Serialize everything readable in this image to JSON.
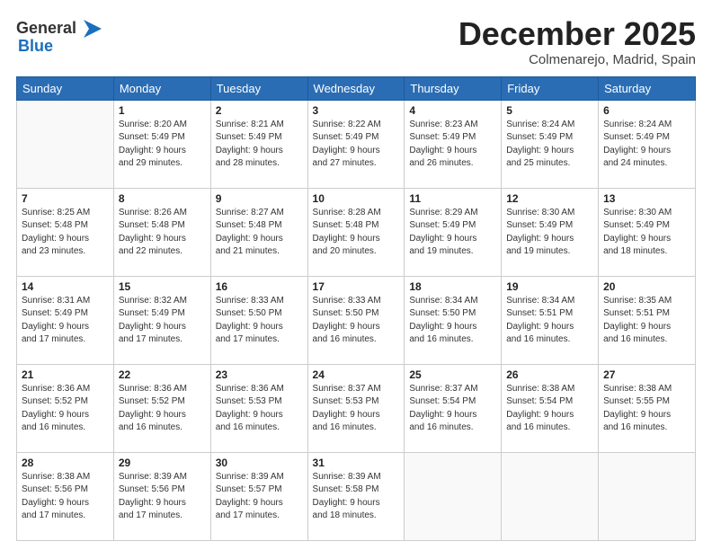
{
  "header": {
    "logo_general": "General",
    "logo_blue": "Blue",
    "month_title": "December 2025",
    "location": "Colmenarejo, Madrid, Spain"
  },
  "weekdays": [
    "Sunday",
    "Monday",
    "Tuesday",
    "Wednesday",
    "Thursday",
    "Friday",
    "Saturday"
  ],
  "weeks": [
    [
      {
        "day": "",
        "info": ""
      },
      {
        "day": "1",
        "info": "Sunrise: 8:20 AM\nSunset: 5:49 PM\nDaylight: 9 hours\nand 29 minutes."
      },
      {
        "day": "2",
        "info": "Sunrise: 8:21 AM\nSunset: 5:49 PM\nDaylight: 9 hours\nand 28 minutes."
      },
      {
        "day": "3",
        "info": "Sunrise: 8:22 AM\nSunset: 5:49 PM\nDaylight: 9 hours\nand 27 minutes."
      },
      {
        "day": "4",
        "info": "Sunrise: 8:23 AM\nSunset: 5:49 PM\nDaylight: 9 hours\nand 26 minutes."
      },
      {
        "day": "5",
        "info": "Sunrise: 8:24 AM\nSunset: 5:49 PM\nDaylight: 9 hours\nand 25 minutes."
      },
      {
        "day": "6",
        "info": "Sunrise: 8:24 AM\nSunset: 5:49 PM\nDaylight: 9 hours\nand 24 minutes."
      }
    ],
    [
      {
        "day": "7",
        "info": "Sunrise: 8:25 AM\nSunset: 5:48 PM\nDaylight: 9 hours\nand 23 minutes."
      },
      {
        "day": "8",
        "info": "Sunrise: 8:26 AM\nSunset: 5:48 PM\nDaylight: 9 hours\nand 22 minutes."
      },
      {
        "day": "9",
        "info": "Sunrise: 8:27 AM\nSunset: 5:48 PM\nDaylight: 9 hours\nand 21 minutes."
      },
      {
        "day": "10",
        "info": "Sunrise: 8:28 AM\nSunset: 5:48 PM\nDaylight: 9 hours\nand 20 minutes."
      },
      {
        "day": "11",
        "info": "Sunrise: 8:29 AM\nSunset: 5:49 PM\nDaylight: 9 hours\nand 19 minutes."
      },
      {
        "day": "12",
        "info": "Sunrise: 8:30 AM\nSunset: 5:49 PM\nDaylight: 9 hours\nand 19 minutes."
      },
      {
        "day": "13",
        "info": "Sunrise: 8:30 AM\nSunset: 5:49 PM\nDaylight: 9 hours\nand 18 minutes."
      }
    ],
    [
      {
        "day": "14",
        "info": "Sunrise: 8:31 AM\nSunset: 5:49 PM\nDaylight: 9 hours\nand 17 minutes."
      },
      {
        "day": "15",
        "info": "Sunrise: 8:32 AM\nSunset: 5:49 PM\nDaylight: 9 hours\nand 17 minutes."
      },
      {
        "day": "16",
        "info": "Sunrise: 8:33 AM\nSunset: 5:50 PM\nDaylight: 9 hours\nand 17 minutes."
      },
      {
        "day": "17",
        "info": "Sunrise: 8:33 AM\nSunset: 5:50 PM\nDaylight: 9 hours\nand 16 minutes."
      },
      {
        "day": "18",
        "info": "Sunrise: 8:34 AM\nSunset: 5:50 PM\nDaylight: 9 hours\nand 16 minutes."
      },
      {
        "day": "19",
        "info": "Sunrise: 8:34 AM\nSunset: 5:51 PM\nDaylight: 9 hours\nand 16 minutes."
      },
      {
        "day": "20",
        "info": "Sunrise: 8:35 AM\nSunset: 5:51 PM\nDaylight: 9 hours\nand 16 minutes."
      }
    ],
    [
      {
        "day": "21",
        "info": "Sunrise: 8:36 AM\nSunset: 5:52 PM\nDaylight: 9 hours\nand 16 minutes."
      },
      {
        "day": "22",
        "info": "Sunrise: 8:36 AM\nSunset: 5:52 PM\nDaylight: 9 hours\nand 16 minutes."
      },
      {
        "day": "23",
        "info": "Sunrise: 8:36 AM\nSunset: 5:53 PM\nDaylight: 9 hours\nand 16 minutes."
      },
      {
        "day": "24",
        "info": "Sunrise: 8:37 AM\nSunset: 5:53 PM\nDaylight: 9 hours\nand 16 minutes."
      },
      {
        "day": "25",
        "info": "Sunrise: 8:37 AM\nSunset: 5:54 PM\nDaylight: 9 hours\nand 16 minutes."
      },
      {
        "day": "26",
        "info": "Sunrise: 8:38 AM\nSunset: 5:54 PM\nDaylight: 9 hours\nand 16 minutes."
      },
      {
        "day": "27",
        "info": "Sunrise: 8:38 AM\nSunset: 5:55 PM\nDaylight: 9 hours\nand 16 minutes."
      }
    ],
    [
      {
        "day": "28",
        "info": "Sunrise: 8:38 AM\nSunset: 5:56 PM\nDaylight: 9 hours\nand 17 minutes."
      },
      {
        "day": "29",
        "info": "Sunrise: 8:39 AM\nSunset: 5:56 PM\nDaylight: 9 hours\nand 17 minutes."
      },
      {
        "day": "30",
        "info": "Sunrise: 8:39 AM\nSunset: 5:57 PM\nDaylight: 9 hours\nand 17 minutes."
      },
      {
        "day": "31",
        "info": "Sunrise: 8:39 AM\nSunset: 5:58 PM\nDaylight: 9 hours\nand 18 minutes."
      },
      {
        "day": "",
        "info": ""
      },
      {
        "day": "",
        "info": ""
      },
      {
        "day": "",
        "info": ""
      }
    ]
  ]
}
